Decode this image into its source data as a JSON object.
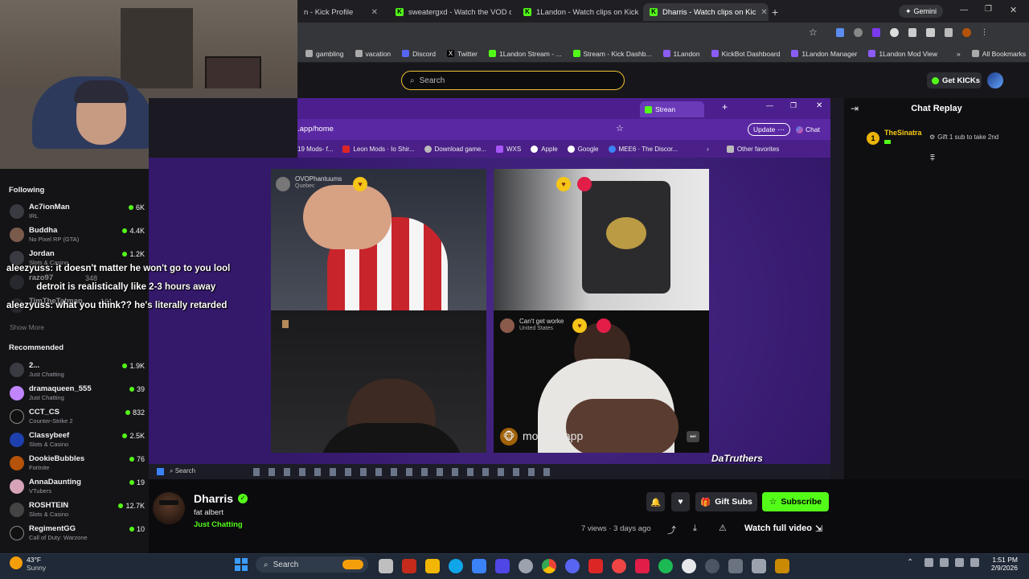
{
  "browser": {
    "tabs": [
      {
        "label": "n - Kick Profile",
        "active": false
      },
      {
        "label": "sweatergxd - Watch the VOD o",
        "active": false
      },
      {
        "label": "1Landon - Watch clips on Kick",
        "active": false
      },
      {
        "label": "Dharris - Watch clips on Kic",
        "active": true
      }
    ],
    "profile_label": "Gemini",
    "bookmarks": [
      "gambling",
      "vacation",
      "Discord",
      "Twitter",
      "1Landon Stream - ...",
      "Stream - Kick Dashb...",
      "1Landon",
      "KickBot Dashboard",
      "1Landon Manager",
      "1Landon Mod View"
    ],
    "all_bookmarks": "All Bookmarks"
  },
  "kick": {
    "search_placeholder": "Search",
    "get_kicks": "Get KICKs"
  },
  "sidebar": {
    "following_title": "Following",
    "following": [
      {
        "name": "Ac7ionMan",
        "category": "IRL",
        "viewers": "6K"
      },
      {
        "name": "Buddha",
        "category": "No Pixel RP (GTA)",
        "viewers": "4.4K"
      },
      {
        "name": "Jordan",
        "category": "Slots & Casino",
        "viewers": "1.2K"
      },
      {
        "name": "razo97",
        "category": "",
        "viewers": "348"
      },
      {
        "name": "TimTheTatman",
        "category": "",
        "viewers": "161"
      }
    ],
    "show_more": "Show More",
    "recommended_title": "Recommended",
    "recommended": [
      {
        "name": "2...",
        "category": "Just Chatting",
        "viewers": "1.9K"
      },
      {
        "name": "dramaqueen_555",
        "category": "Just Chatting",
        "viewers": "39"
      },
      {
        "name": "CCT_CS",
        "category": "Counter-Strike 2",
        "viewers": "832"
      },
      {
        "name": "Classybeef",
        "category": "Slots & Casino",
        "viewers": "2.5K"
      },
      {
        "name": "DookieBubbles",
        "category": "Fortnite",
        "viewers": "76"
      },
      {
        "name": "AnnaDaunting",
        "category": "VTubers",
        "viewers": "19"
      },
      {
        "name": "ROSHTEIN",
        "category": "Slots & Casino",
        "viewers": "12.7K"
      },
      {
        "name": "RegimentGG",
        "category": "Call of Duty: Warzone",
        "viewers": "10"
      }
    ]
  },
  "overlay_chat": [
    {
      "user": "aleezyuss:",
      "message": "it doesn't matter he won't go to you lool"
    },
    {
      "user": "",
      "message": "detroit is realistically like 2-3 hours away"
    },
    {
      "user": "aleezyuss:",
      "message": "what you think?? he's literally retarded"
    }
  ],
  "inner_browser": {
    "tab_label": "Strean",
    "address": ".app/home",
    "update_label": "Update",
    "chat_label": "Chat",
    "bookmarks": [
      "19 Mods- f...",
      "Leon Mods · Io Shir...",
      "Download game...",
      "WXS",
      "Apple",
      "Google",
      "MEE6 · The Discor..."
    ],
    "other_favorites": "Other favorites",
    "cams": [
      {
        "user": "OVOPhantuums",
        "location": "Quebec"
      },
      {
        "user": "",
        "location": ""
      },
      {
        "user": "",
        "location": ""
      },
      {
        "user": "Can't get worke",
        "location": "United States"
      }
    ],
    "monkey_label": "monkey.app",
    "watermark": "DaTruthers",
    "taskbar_search": "Search"
  },
  "chat_replay": {
    "title": "Chat Replay",
    "entries": [
      {
        "user": "TheSinatra",
        "badge": "1",
        "message": "Gift 1 sub to take 2nd"
      }
    ]
  },
  "stream": {
    "streamer": "Dharris",
    "title": "fat albert",
    "category": "Just Chatting",
    "gift_subs": "Gift Subs",
    "subscribe": "Subscribe",
    "views": "7 views",
    "age": "3 days ago",
    "watch_full": "Watch full video"
  },
  "taskbar": {
    "weather_temp": "43°F",
    "weather_desc": "Sunny",
    "search": "Search",
    "time": "1:51 PM",
    "date": "2/9/2026"
  },
  "colors": {
    "kick_green": "#53fc18",
    "purple": "#3e1b74",
    "chrome": "#35363a"
  }
}
